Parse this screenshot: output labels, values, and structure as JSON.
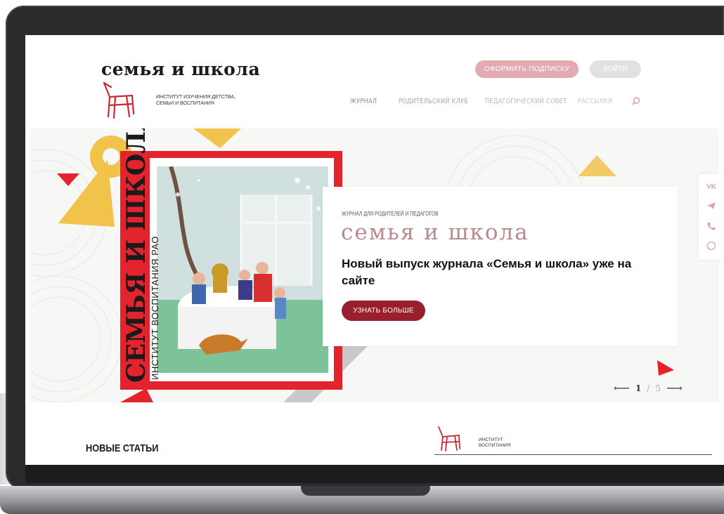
{
  "header": {
    "logo_title": "семья и школа",
    "logo_caption": "ИНСТИТУТ ИЗУЧЕНИЯ ДЕТСТВА, СЕМЬИ И ВОСПИТАНИЯ",
    "subscribe_label": "ОФОРМИТЬ ПОДПИСКУ",
    "login_label": "ВОЙТИ",
    "nav": {
      "journal": "ЖУРНАЛ",
      "club": "РОДИТЕЛЬСКИЙ КЛУБ",
      "council": "ПЕДАГОГИЧЕСКИЙ СОВЕТ",
      "mailings": "РАССЫЛКИ"
    },
    "search_icon": "search-icon"
  },
  "hero": {
    "cover_title": "СЕМЬЯ И ШКОЛА",
    "cover_subtitle": "ИНСТИТУТ ВОСПИТАНИЯ РАО",
    "kicker": "ЖУРНАЛ ДЛЯ РОДИТЕЛЕЙ И ПЕДАГОГОВ",
    "brand": "семья и школа",
    "headline": "Новый выпуск журнала «Семья и школа» уже на сайте",
    "cta_label": "УЗНАТЬ БОЛЬШЕ",
    "pager": {
      "current": "1",
      "separator": "/",
      "total": "5",
      "prev_icon": "arrow-left-icon",
      "next_icon": "arrow-right-icon"
    }
  },
  "social": [
    "vk-icon",
    "telegram-icon",
    "phone-icon",
    "whatsapp-icon"
  ],
  "vk_label": "VK",
  "bottom": {
    "section_title": "НОВЫЕ СТАТЬИ",
    "institute_caption": "ИНСТИТУТ ВОСПИТАНИЯ"
  },
  "colors": {
    "accent_red": "#e3232d",
    "cta_dark_red": "#9a1f2c",
    "subscribe_pink": "#e4aab1",
    "login_grey": "#e1e1e1",
    "deco_yellow": "#f1c34a"
  }
}
